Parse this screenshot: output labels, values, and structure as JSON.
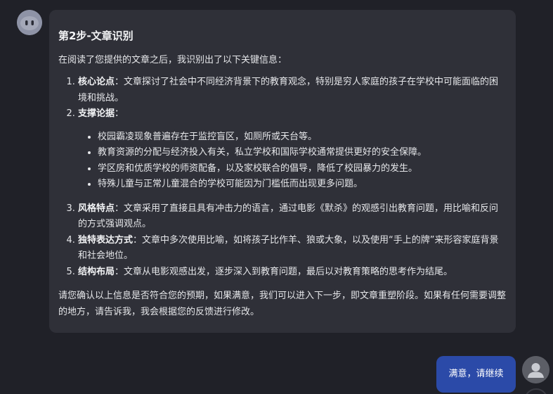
{
  "assistant_message": {
    "title": "第2步-文章识别",
    "intro": "在阅读了您提供的文章之后，我识别出了以下关键信息：",
    "items": [
      {
        "label": "核心论点",
        "text": "：文章探讨了社会中不同经济背景下的教育观念，特别是穷人家庭的孩子在学校中可能面临的困境和挑战。"
      },
      {
        "label": "支撑论据",
        "text": "："
      },
      {
        "label": "风格特点",
        "text": "：文章采用了直接且具有冲击力的语言，通过电影《默杀》的观感引出教育问题，用比喻和反问的方式强调观点。"
      },
      {
        "label": "独特表达方式",
        "text": "：文章中多次使用比喻，如将孩子比作羊、狼或大象，以及使用“手上的牌”来形容家庭背景和社会地位。"
      },
      {
        "label": "结构布局",
        "text": "：文章从电影观感出发，逐步深入到教育问题，最后以对教育策略的思考作为结尾。"
      }
    ],
    "sub_items": [
      "校园霸凌现象普遍存在于监控盲区，如厕所或天台等。",
      "教育资源的分配与经济投入有关，私立学校和国际学校通常提供更好的安全保障。",
      "学区房和优质学校的师资配备，以及家校联合的倡导，降低了校园暴力的发生。",
      "特殊儿童与正常儿童混合的学校可能因为门槛低而出现更多问题。"
    ],
    "closing": "请您确认以上信息是否符合您的预期，如果满意，我们可以进入下一步，即文章重塑阶段。如果有任何需要调整的地方，请告诉我，我会根据您的反馈进行修改。"
  },
  "user_message": {
    "text": "满意，请继续"
  },
  "icons": {
    "bot_avatar": "bot-face-icon",
    "user_avatar": "user-silhouette-icon"
  },
  "colors": {
    "background": "#202128",
    "assistant_bubble": "#2f3038",
    "user_bubble": "#2b4aa8"
  }
}
